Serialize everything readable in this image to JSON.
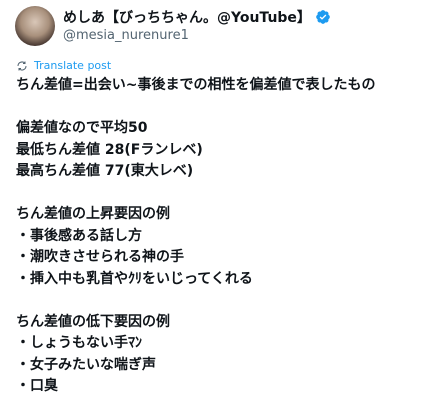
{
  "author": {
    "display_name": "めしあ【びっちちゃん。@YouTube】",
    "handle": "@mesia_nurenure1",
    "avatar_icon": "avatar-photo",
    "verified_icon": "verified-badge-icon"
  },
  "translate_link": "Translate post",
  "post_lines": [
    "ちん差値=出会い~事後までの相性を偏差値で表したもの",
    "",
    "偏差値なので平均50",
    "最低ちん差値 28(Fランレベ)",
    "最高ちん差値 77(東大レベ)",
    "",
    "ちん差値の上昇要因の例",
    "・事後感ある話し方",
    "・潮吹きさせられる神の手",
    "・挿入中も乳首やｸﾘをいじってくれる",
    "",
    "ちん差値の低下要因の例",
    "・しょうもない手ﾏﾝ",
    "・女子みたいな喘ぎ声",
    "・口臭"
  ],
  "colors": {
    "text": "#0f1419",
    "secondary": "#536471",
    "accent": "#1d9bf0"
  }
}
